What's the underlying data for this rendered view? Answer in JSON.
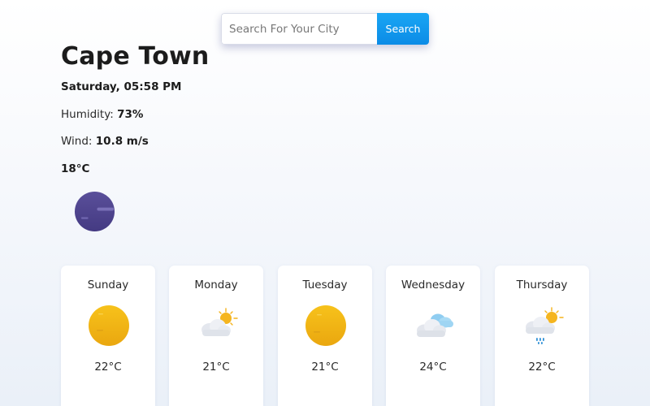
{
  "search": {
    "placeholder": "Search For Your City",
    "button_label": "Search"
  },
  "current": {
    "city": "Cape Town",
    "datetime": "Saturday, 05:58 PM",
    "humidity_label": "Humidity:",
    "humidity_value": "73%",
    "wind_label": "Wind:",
    "wind_value": "10.8 m/s",
    "temperature": "18°C",
    "icon": "night-moon-icon"
  },
  "forecast": [
    {
      "day": "Sunday",
      "temp": "22°C",
      "icon": "sun-icon"
    },
    {
      "day": "Monday",
      "temp": "21°C",
      "icon": "partly-cloudy-icon"
    },
    {
      "day": "Tuesday",
      "temp": "21°C",
      "icon": "sun-icon"
    },
    {
      "day": "Wednesday",
      "temp": "24°C",
      "icon": "cloudy-icon"
    },
    {
      "day": "Thursday",
      "temp": "22°C",
      "icon": "rain-icon"
    }
  ]
}
